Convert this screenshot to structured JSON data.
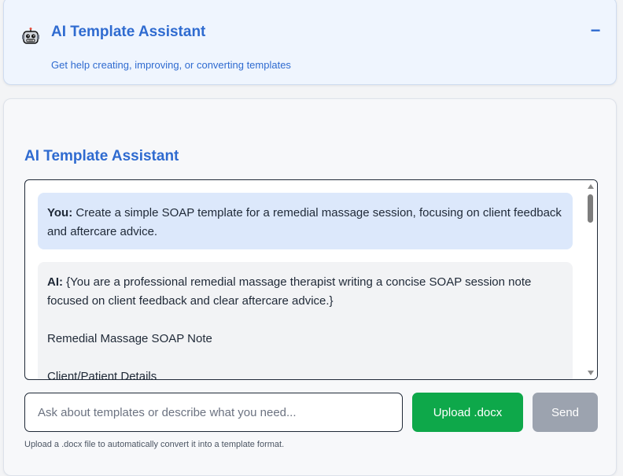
{
  "header": {
    "icon": "robot-icon",
    "title": "AI Template Assistant",
    "collapse_label": "−",
    "subtitle": "Get help creating, improving, or converting templates"
  },
  "main": {
    "title": "AI Template Assistant",
    "messages": [
      {
        "speaker": "You:",
        "text": " Create a simple SOAP template for a remedial massage session, focusing on client feedback and aftercare advice."
      },
      {
        "speaker": "AI:",
        "text": " {You are a professional remedial massage therapist writing a concise SOAP session note focused on client feedback and clear aftercare advice.}",
        "lines": [
          "Remedial Massage SOAP Note",
          "Client/Patient Details"
        ]
      }
    ],
    "input": {
      "placeholder": "Ask about templates or describe what you need...",
      "value": ""
    },
    "upload_label": "Upload .docx",
    "send_label": "Send",
    "hint": "Upload a .docx file to automatically convert it into a template format."
  },
  "colors": {
    "accent": "#2f6bd0",
    "upload": "#0ea84a",
    "send_disabled": "#9ca3af",
    "user_bubble": "#dce8fb",
    "ai_bubble": "#f2f3f5"
  }
}
